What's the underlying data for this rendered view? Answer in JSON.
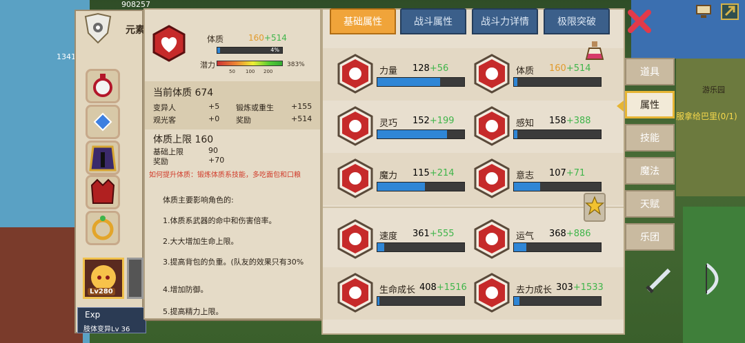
{
  "element_label": "元素",
  "character": {
    "level_badge": "Lv280",
    "exp_title": "Exp",
    "subtitle": "肢体变异Lv 36"
  },
  "detail": {
    "attribute_name": "体质",
    "base": "160",
    "bonus": "+514",
    "bar_percent": "4%",
    "bar_fraction": 0.04,
    "potential_label": "潜力",
    "potential_percent": "383%",
    "potential_ticks": [
      "50",
      "100",
      "200"
    ],
    "current_title": "当前体质 674",
    "current_rows": [
      {
        "label": "变异人",
        "value": "+5"
      },
      {
        "label": "锻炼或重生",
        "value": "+155"
      },
      {
        "label": "观光客",
        "value": "+0"
      },
      {
        "label": "奖励",
        "value": "+514"
      }
    ],
    "cap_title": "体质上限 160",
    "cap_rows": [
      {
        "label": "基础上限",
        "value": "90"
      },
      {
        "label": "奖励",
        "value": "+70"
      }
    ],
    "hint": "如何提升体质：锻炼体质系技能，多吃面包和口粮",
    "desc_title": "体质主要影响角色的:",
    "desc_lines": [
      "1.体质系武器的命中和伤害倍率。",
      "2.大大增加生命上限。",
      "3.提高背包的负重。(队友的效果只有30%",
      "4.增加防御。",
      "5.提高精力上限。"
    ]
  },
  "tabs": [
    "基础属性",
    "战斗属性",
    "战斗力详情",
    "极限突破"
  ],
  "active_tab": 0,
  "stats": [
    {
      "name": "力量",
      "base": "128",
      "bonus": "+56",
      "fill": 0.72,
      "icon": "arm-icon"
    },
    {
      "name": "体质",
      "base": "160",
      "bonus": "+514",
      "fill": 0.04,
      "icon": "heart-chest-icon"
    },
    {
      "name": "灵巧",
      "base": "152",
      "bonus": "+199",
      "fill": 0.8,
      "icon": "runner-icon"
    },
    {
      "name": "感知",
      "base": "158",
      "bonus": "+388",
      "fill": 0.04,
      "icon": "eye-icon"
    },
    {
      "name": "魔力",
      "base": "115",
      "bonus": "+214",
      "fill": 0.55,
      "icon": "spiral-icon"
    },
    {
      "name": "意志",
      "base": "107",
      "bonus": "+71",
      "fill": 0.3,
      "icon": "head-bolt-icon"
    },
    {
      "name": "速度",
      "base": "361",
      "bonus": "+555",
      "fill": 0.08,
      "icon": "wing-icon"
    },
    {
      "name": "运气",
      "base": "368",
      "bonus": "+886",
      "fill": 0.14,
      "icon": "clover-icon"
    },
    {
      "name": "生命成长",
      "base": "408",
      "bonus": "+1516",
      "fill": 0.02,
      "icon": "life-heart-icon"
    },
    {
      "name": "去力成长",
      "base": "303",
      "bonus": "+1533",
      "fill": 0.06,
      "icon": "flower-icon"
    }
  ],
  "side_nav": [
    "道具",
    "属性",
    "技能",
    "魔法",
    "天赋",
    "乐团"
  ],
  "active_side": 1,
  "world": {
    "park_label": "游乐园",
    "quest_text": "服拿给巴里(0/1)",
    "coins_top": "908257",
    "left_num": "1341"
  }
}
